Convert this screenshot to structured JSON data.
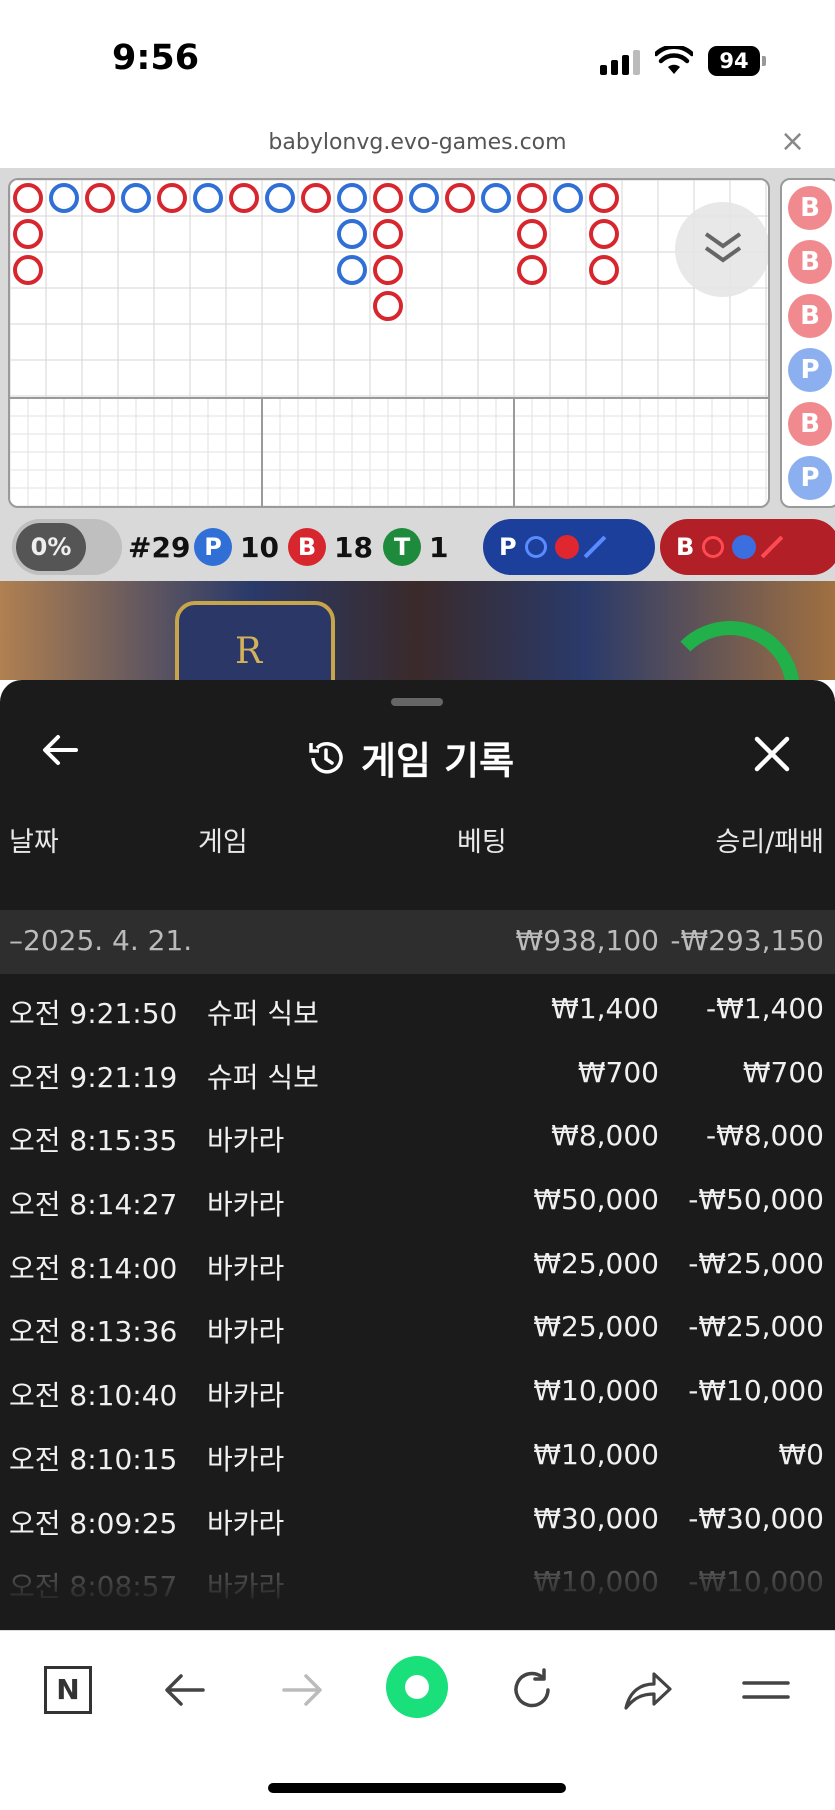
{
  "status": {
    "time": "9:56",
    "battery": "94"
  },
  "browser": {
    "url": "babylonvg.evo-games.com",
    "close": "×"
  },
  "game": {
    "toggle_label": "0%",
    "shoe": "#29",
    "stats": [
      {
        "letter": "P",
        "value": "10",
        "color": "#2f6fd6"
      },
      {
        "letter": "B",
        "value": "18",
        "color": "#d8262f"
      },
      {
        "letter": "T",
        "value": "1",
        "color": "#1e8a3c"
      }
    ],
    "predict_player": "P",
    "predict_banker": "B",
    "side_road": [
      "B",
      "B",
      "B",
      "P",
      "B",
      "P"
    ],
    "crest_letter": "R"
  },
  "history": {
    "title": "게임 기록",
    "columns": {
      "date": "날짜",
      "game": "게임",
      "bet": "베팅",
      "result": "승리/패배"
    },
    "summary": {
      "date": "–2025. 4. 21.",
      "bet": "₩938,100",
      "result": "-₩293,150"
    },
    "rows": [
      {
        "time": "오전 9:21:50",
        "game": "슈퍼 식보",
        "bet": "₩1,400",
        "result": "-₩1,400"
      },
      {
        "time": "오전 9:21:19",
        "game": "슈퍼 식보",
        "bet": "₩700",
        "result": "₩700"
      },
      {
        "time": "오전 8:15:35",
        "game": "바카라",
        "bet": "₩8,000",
        "result": "-₩8,000"
      },
      {
        "time": "오전 8:14:27",
        "game": "바카라",
        "bet": "₩50,000",
        "result": "-₩50,000"
      },
      {
        "time": "오전 8:14:00",
        "game": "바카라",
        "bet": "₩25,000",
        "result": "-₩25,000"
      },
      {
        "time": "오전 8:13:36",
        "game": "바카라",
        "bet": "₩25,000",
        "result": "-₩25,000"
      },
      {
        "time": "오전 8:10:40",
        "game": "바카라",
        "bet": "₩10,000",
        "result": "-₩10,000"
      },
      {
        "time": "오전 8:10:15",
        "game": "바카라",
        "bet": "₩10,000",
        "result": "₩0"
      },
      {
        "time": "오전 8:09:25",
        "game": "바카라",
        "bet": "₩30,000",
        "result": "-₩30,000"
      },
      {
        "time": "오전 8:08:57",
        "game": "바카라",
        "bet": "₩10,000",
        "result": "-₩10,000"
      }
    ]
  },
  "toolbar": {
    "icons": [
      "naver-icon",
      "back-icon",
      "forward-icon",
      "home-icon",
      "reload-icon",
      "share-icon",
      "menu-icon"
    ],
    "naver_letter": "N"
  }
}
